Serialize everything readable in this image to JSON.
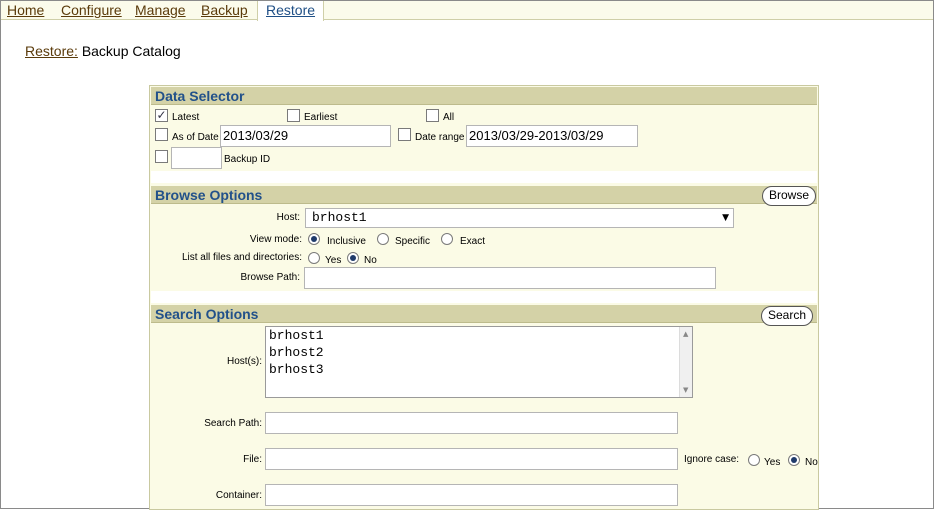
{
  "nav": {
    "tabs": [
      {
        "label": "Home"
      },
      {
        "label": "Configure"
      },
      {
        "label": "Manage"
      },
      {
        "label": "Backup"
      },
      {
        "label": "Restore"
      }
    ]
  },
  "breadcrumb": {
    "link": "Restore:",
    "current": "Backup Catalog"
  },
  "data_selector": {
    "title": "Data Selector",
    "latest_label": "Latest",
    "earliest_label": "Earliest",
    "all_label": "All",
    "as_of_date_label": "As of Date",
    "as_of_date_value": "2013/03/29",
    "date_range_label": "Date range",
    "date_range_value": "2013/03/29-2013/03/29",
    "backup_id_label": "Backup ID",
    "backup_id_value": ""
  },
  "browse": {
    "title": "Browse Options",
    "button": "Browse",
    "host_label": "Host:",
    "host_value": "brhost1",
    "view_mode_label": "View mode:",
    "inclusive": "Inclusive",
    "specific": "Specific",
    "exact": "Exact",
    "list_all_label": "List all files and directories:",
    "yes": "Yes",
    "no": "No",
    "path_label": "Browse Path:",
    "path_value": ""
  },
  "search": {
    "title": "Search Options",
    "button": "Search",
    "hosts_label": "Host(s):",
    "hosts": [
      "brhost1",
      "brhost2",
      "brhost3"
    ],
    "path_label": "Search Path:",
    "file_label": "File:",
    "ignore_case_label": "Ignore case:",
    "yes": "Yes",
    "no": "No",
    "container_label": "Container:"
  }
}
